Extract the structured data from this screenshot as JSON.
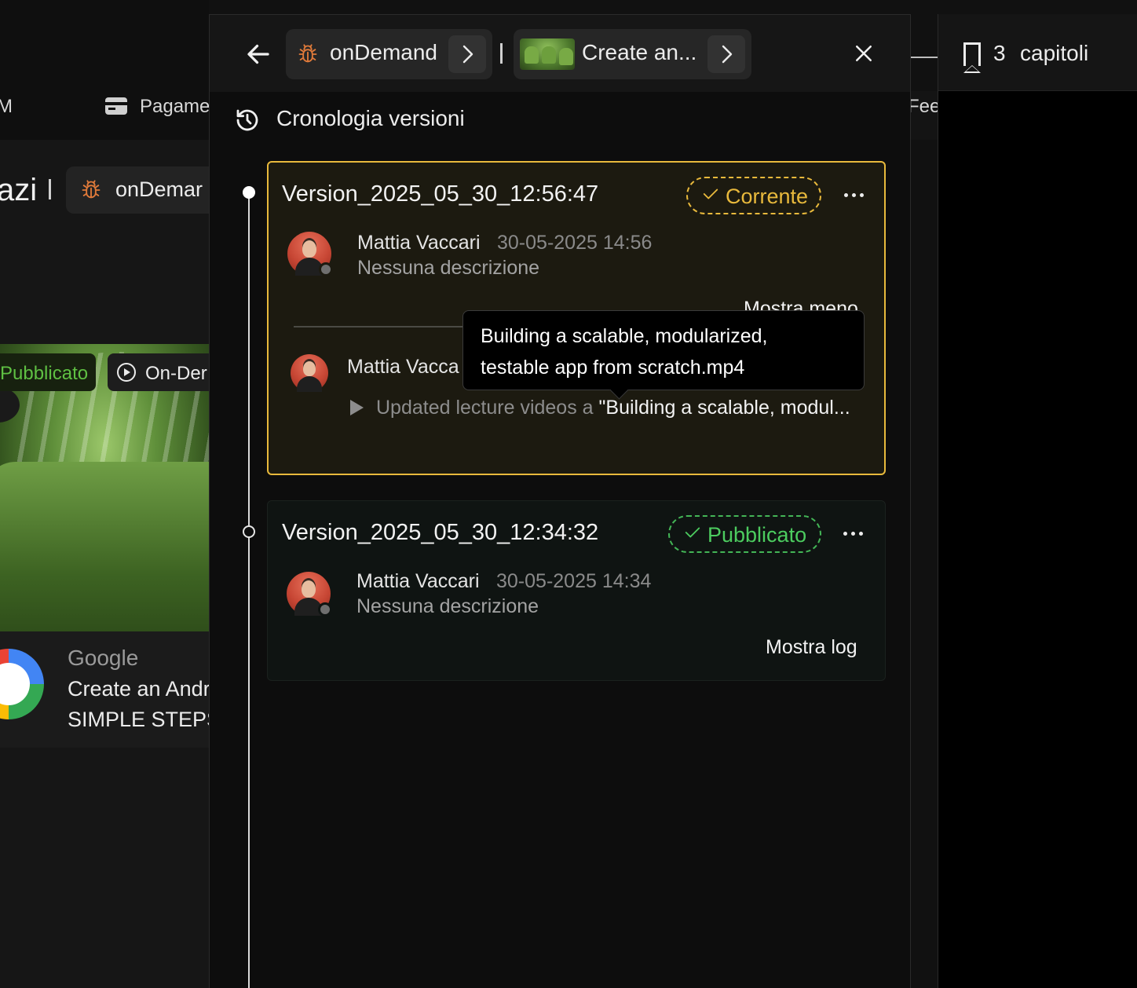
{
  "background": {
    "nav_left_fragment": "M",
    "nav_payments": "Pagame",
    "nav_right_fragment": "Feed",
    "title_fragment": "azi",
    "course_chip": "onDemar",
    "badge_published": "Pubblicato",
    "badge_ondemand": "On-Der",
    "provider": "Google",
    "course_title_line1": "Create an Andr",
    "course_title_line2": "SIMPLE STEPS",
    "chapters_count": "3",
    "chapters_label": "capitoli"
  },
  "header": {
    "crumb1_label": "onDemand",
    "crumb2_label": "Create an..."
  },
  "history": {
    "title": "Cronologia versioni"
  },
  "versions": [
    {
      "name": "Version_2025_05_30_12:56:47",
      "status": "Corrente",
      "author": "Mattia Vaccari",
      "date": "30-05-2025 14:56",
      "description": "Nessuna descrizione",
      "toggle_label": "Mostra meno",
      "log": {
        "author": "Mattia Vacca",
        "action": "Updated lecture videos a ",
        "file": "\"Building a scalable, modul..."
      }
    },
    {
      "name": "Version_2025_05_30_12:34:32",
      "status": "Pubblicato",
      "author": "Mattia Vaccari",
      "date": "30-05-2025 14:34",
      "description": "Nessuna descrizione",
      "toggle_label": "Mostra log"
    }
  ],
  "tooltip": {
    "line1": "Building a scalable, modularized,",
    "line2": "testable app from scratch.mp4"
  },
  "colors": {
    "current_accent": "#e8b93c",
    "published_accent": "#4ccc5f",
    "bug_icon": "#e07a3a"
  },
  "icons": [
    "arrow-left-icon",
    "bug-icon",
    "chevron-right-icon",
    "close-icon",
    "history-icon",
    "check-icon",
    "more-icon",
    "play-icon",
    "bookmark-icon",
    "credit-card-icon"
  ]
}
